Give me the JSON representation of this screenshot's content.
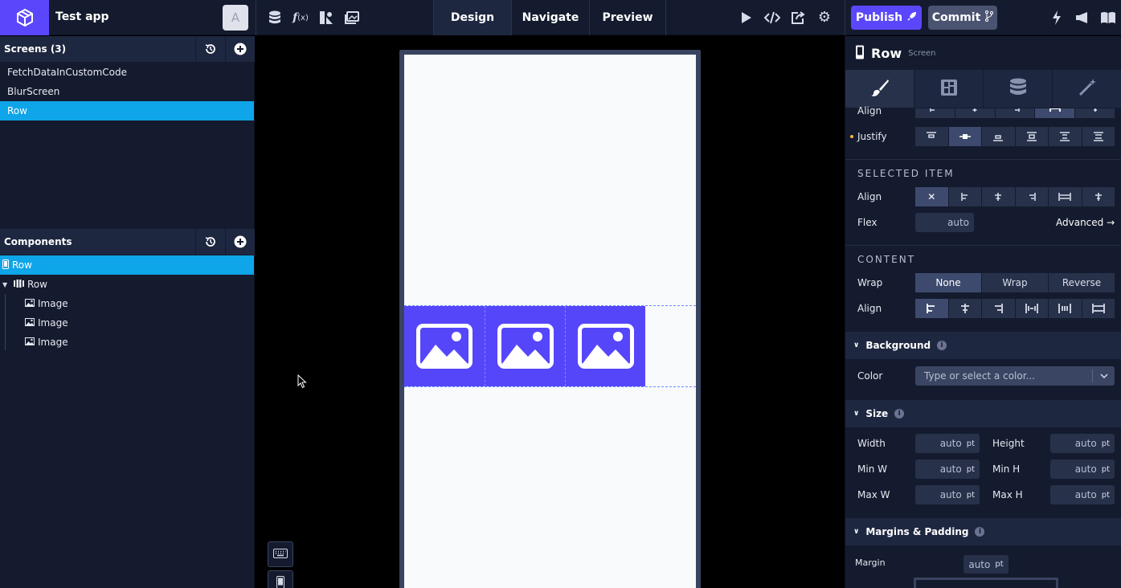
{
  "app": {
    "title": "Test app",
    "avatar_letter": "A"
  },
  "modes": [
    "Design",
    "Navigate",
    "Preview"
  ],
  "header": {
    "publish_label": "Publish",
    "commit_label": "Commit"
  },
  "screens": {
    "title": "Screens (3)",
    "items": [
      "FetchDataInCustomCode",
      "BlurScreen",
      "Row"
    ],
    "selected": "Row"
  },
  "components": {
    "title": "Components",
    "tree": [
      {
        "label": "Row",
        "level": 0,
        "icon": "phone-icon",
        "selected": true
      },
      {
        "label": "Row",
        "level": 1,
        "icon": "row-layout-icon",
        "expanded": true
      },
      {
        "label": "Image",
        "level": 2,
        "icon": "image-icon"
      },
      {
        "label": "Image",
        "level": 2,
        "icon": "image-icon"
      },
      {
        "label": "Image",
        "level": 2,
        "icon": "image-icon"
      }
    ]
  },
  "inspector": {
    "title": "Row",
    "subtitle": "Screen",
    "align_label": "Align",
    "justify_label": "Justify",
    "selected_item": {
      "heading": "SELECTED ITEM",
      "align_label": "Align",
      "flex_label": "Flex",
      "flex_value": "auto",
      "advanced_label": "Advanced →"
    },
    "content": {
      "heading": "CONTENT",
      "wrap_label": "Wrap",
      "wrap_options": [
        "None",
        "Wrap",
        "Reverse"
      ],
      "wrap_selected": "None",
      "align_label": "Align"
    },
    "background": {
      "heading": "Background",
      "color_label": "Color",
      "color_placeholder": "Type or select a color..."
    },
    "size": {
      "heading": "Size",
      "width_label": "Width",
      "width_value": "auto",
      "height_label": "Height",
      "height_value": "auto",
      "minw_label": "Min W",
      "minw_value": "auto",
      "minh_label": "Min H",
      "minh_value": "auto",
      "maxw_label": "Max W",
      "maxw_value": "auto",
      "maxh_label": "Max H",
      "maxh_value": "auto",
      "unit": "pt"
    },
    "margins": {
      "heading": "Margins & Padding",
      "margin_label": "Margin",
      "margin_value": "auto",
      "unit": "pt"
    }
  },
  "colors": {
    "brand": "#5b47fb",
    "selection": "#0ea5e9",
    "panel": "#141b2e",
    "indicator": "#f5b731"
  }
}
